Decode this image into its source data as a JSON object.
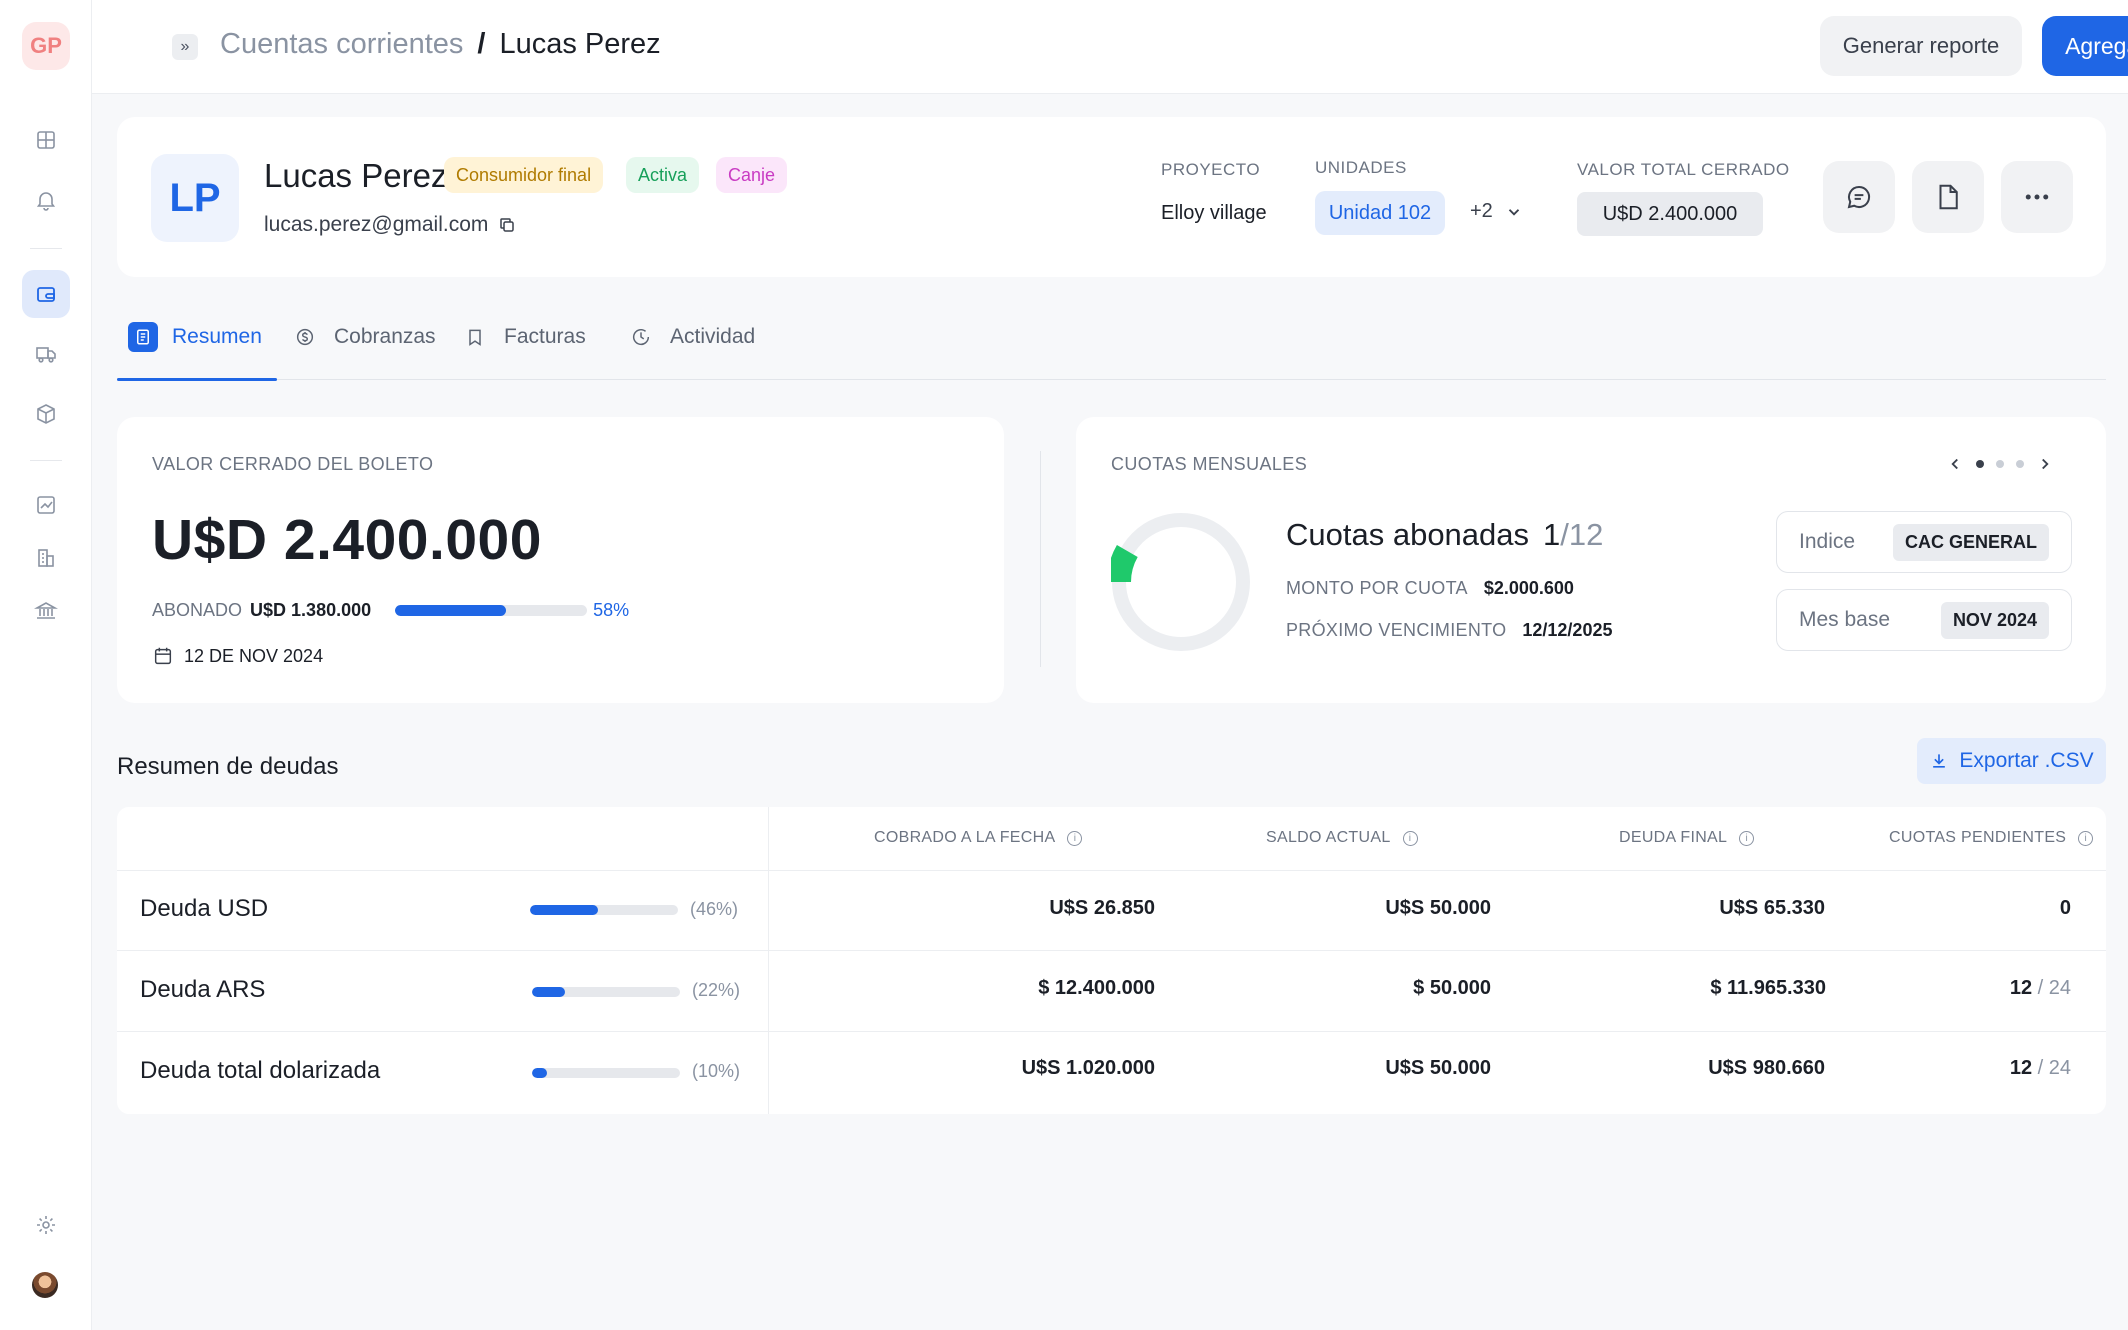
{
  "app": {
    "logo": "GP"
  },
  "sidebar": {
    "icons": [
      "grid-icon",
      "bell-icon",
      "wallet-icon",
      "truck-icon",
      "box-icon",
      "chart-icon",
      "building-icon",
      "bank-icon",
      "settings-icon"
    ]
  },
  "topbar": {
    "crumb_parent": "Cuentas corrientes",
    "crumb_sep": "/",
    "crumb_current": "Lucas Perez",
    "report_label": "Generar reporte",
    "add_label": "Agregar"
  },
  "client": {
    "initials": "LP",
    "name": "Lucas Perez",
    "tags": [
      "Consumidor final",
      "Activa",
      "Canje"
    ],
    "email": "lucas.perez@gmail.com",
    "project_label": "PROYECTO",
    "project_value": "Elloy village",
    "units_label": "UNIDADES",
    "unit_value": "Unidad 102",
    "units_more": "+2",
    "total_label": "VALOR TOTAL CERRADO",
    "total_value": "U$D 2.400.000"
  },
  "tabs": [
    {
      "label": "Resumen",
      "icon": "document-icon"
    },
    {
      "label": "Cobranzas",
      "icon": "coin-icon"
    },
    {
      "label": "Facturas",
      "icon": "bookmark-icon"
    },
    {
      "label": "Actividad",
      "icon": "clock-icon"
    }
  ],
  "boleto": {
    "caption": "VALOR CERRADO DEL BOLETO",
    "value": "U$D 2.400.000",
    "abonado_label": "ABONADO",
    "abonado_value": "U$D 1.380.000",
    "progress": 58,
    "progress_label": "58%",
    "date": "12 DE NOV 2024"
  },
  "cuotas": {
    "caption": "CUOTAS MENSUALES",
    "title": "Cuotas abonadas",
    "paid": "1",
    "total": "/12",
    "paid_fraction": 0.0833,
    "monto_label": "MONTO POR CUOTA",
    "monto_value": "$2.000.600",
    "prox_label": "PRÓXIMO VENCIMIENTO",
    "prox_value": "12/12/2025",
    "indice_label": "Indice",
    "indice_value": "CAC GENERAL",
    "mesbase_label": "Mes base",
    "mesbase_value": "NOV 2024"
  },
  "deudas": {
    "title": "Resumen de deudas",
    "export_label": "Exportar .CSV",
    "headers": [
      "COBRADO A LA FECHA",
      "SALDO ACTUAL",
      "DEUDA FINAL",
      "CUOTAS PENDIENTES"
    ],
    "rows": [
      {
        "name": "Deuda USD",
        "pct": 46,
        "pct_label": "(46%)",
        "cobrado": "U$S 26.850",
        "saldo": "U$S 50.000",
        "final": "U$S 65.330",
        "pend": "0",
        "pend_total": ""
      },
      {
        "name": "Deuda ARS",
        "pct": 22,
        "pct_label": "(22%)",
        "cobrado": "$ 12.400.000",
        "saldo": "$ 50.000",
        "final": "$ 11.965.330",
        "pend": "12",
        "pend_total": " / 24"
      },
      {
        "name": "Deuda total dolarizada",
        "pct": 10,
        "pct_label": "(10%)",
        "cobrado": "U$S 1.020.000",
        "saldo": "U$S 50.000",
        "final": "U$S 980.660",
        "pend": "12",
        "pend_total": " / 24"
      }
    ]
  },
  "colors": {
    "accent": "#1f66e5",
    "success": "#1fc96b"
  }
}
